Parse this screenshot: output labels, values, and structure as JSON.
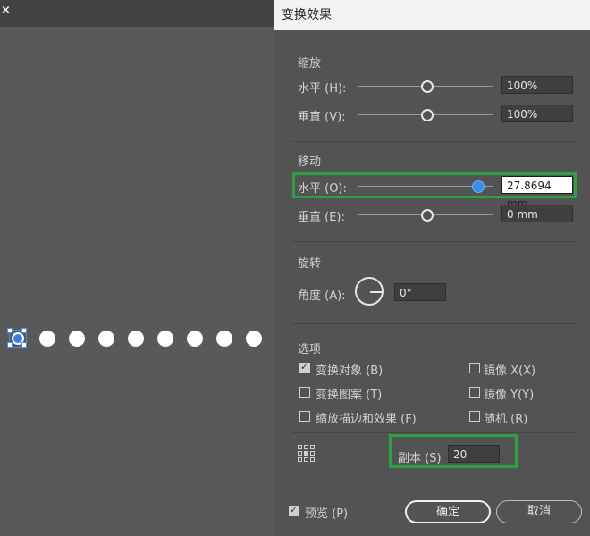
{
  "topbar": {
    "close_glyph": "×"
  },
  "dialog": {
    "title": "变换效果",
    "scale": {
      "section": "缩放",
      "horizontal_label": "水平 (H):",
      "horizontal_value": "100%",
      "vertical_label": "垂直 (V):",
      "vertical_value": "100%"
    },
    "move": {
      "section": "移动",
      "horizontal_label": "水平 (O):",
      "horizontal_value": "27.8694 mm",
      "vertical_label": "垂直 (E):",
      "vertical_value": "0 mm"
    },
    "rotate": {
      "section": "旋转",
      "angle_label": "角度 (A):",
      "angle_value": "0°"
    },
    "options": {
      "section": "选项",
      "transform_objects": {
        "label": "变换对象 (B)",
        "checked": true
      },
      "transform_patterns": {
        "label": "变换图案 (T)",
        "checked": false
      },
      "scale_strokes": {
        "label": "缩放描边和效果 (F)",
        "checked": false
      },
      "reflect_x": {
        "label": "镜像 X(X)",
        "checked": false
      },
      "reflect_y": {
        "label": "镜像 Y(Y)",
        "checked": false
      },
      "random": {
        "label": "随机 (R)",
        "checked": false
      }
    },
    "copies": {
      "label": "副本 (S)",
      "value": "20"
    },
    "preview": {
      "label": "预览 (P)",
      "checked": true
    },
    "ok_label": "确定",
    "cancel_label": "取消"
  },
  "colors": {
    "highlight": "#2ea043",
    "slider_active": "#3b8ee6"
  }
}
